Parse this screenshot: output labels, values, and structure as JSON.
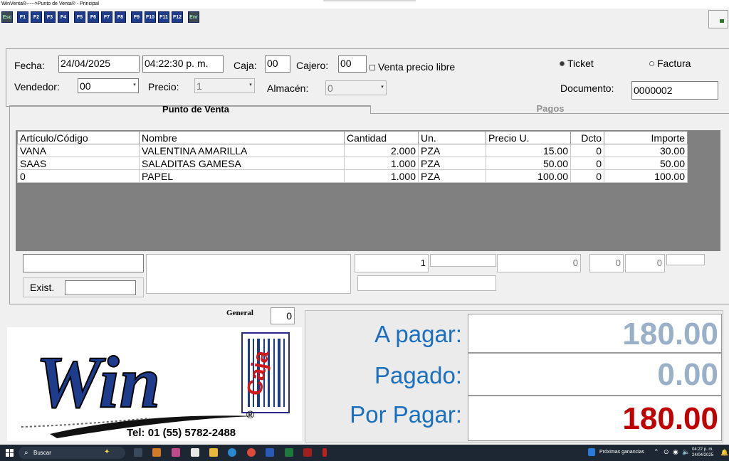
{
  "window": {
    "title": "WinVenta®----->Punto de Venta® - Principal"
  },
  "toolbar": {
    "buttons": [
      "Esc",
      "F1",
      "F2",
      "F3",
      "F4",
      "F5",
      "F6",
      "F7",
      "F8",
      "F9",
      "F10",
      "F11",
      "F12",
      "Enr"
    ]
  },
  "form": {
    "fecha_label": "Fecha:",
    "fecha_value": "24/04/2025",
    "hora_value": "04:22:30 p. m.",
    "caja_label": "Caja:",
    "caja_value": "00",
    "cajero_label": "Cajero:",
    "cajero_value": "00",
    "venta_libre_label": "Venta  precio libre",
    "ticket_label": "Ticket",
    "factura_label": "Factura",
    "vendedor_label": "Vendedor:",
    "vendedor_value": "00",
    "precio_label": "Precio:",
    "precio_value": "1",
    "almacen_label": "Almacén:",
    "almacen_value": "0",
    "documento_label": "Documento:",
    "documento_value": "0000002"
  },
  "tabs": [
    {
      "label": "Punto de Venta"
    },
    {
      "label": "Pagos"
    }
  ],
  "grid": {
    "headers": [
      "Artículo/Código",
      "Nombre",
      "Cantidad",
      "Un.",
      "Precio U.",
      "Dcto",
      "Importe"
    ],
    "rows": [
      {
        "codigo": "VANA",
        "nombre": "VALENTINA AMARILLA",
        "cantidad": "2.000",
        "un": "PZA",
        "precio": "15.00",
        "dcto": "0",
        "importe": "30.00"
      },
      {
        "codigo": "SAAS",
        "nombre": "SALADITAS GAMESA",
        "cantidad": "1.000",
        "un": "PZA",
        "precio": "50.00",
        "dcto": "0",
        "importe": "50.00"
      },
      {
        "codigo": "0",
        "nombre": "PAPEL",
        "cantidad": "1.000",
        "un": "PZA",
        "precio": "100.00",
        "dcto": "0",
        "importe": "100.00"
      }
    ]
  },
  "entry": {
    "cantidad": "1",
    "precio": "0",
    "dcto1": "0",
    "dcto2": "0",
    "exist_label": "Exist."
  },
  "general": {
    "label": "General",
    "value": "0"
  },
  "totals": {
    "a_pagar_label": "A pagar:",
    "a_pagar_value": "180.00",
    "pagado_label": "Pagado:",
    "pagado_value": "0.00",
    "por_pagar_label": "Por Pagar:",
    "por_pagar_value": "180.00"
  },
  "logo": {
    "word": "Win",
    "stamp": "Caja",
    "registered": "®",
    "phone": "Tel: 01 (55) 5782-2488"
  },
  "taskbar": {
    "search_placeholder": "Buscar",
    "news_text": "Próximas ganancias",
    "clock_time": "04:22 p. m.",
    "clock_date": "24/04/2025"
  },
  "colors": {
    "label_blue": "#1a6fbf",
    "value_gray": "#9ab0c8",
    "value_red": "#c00000",
    "grid_gray": "#808080"
  }
}
